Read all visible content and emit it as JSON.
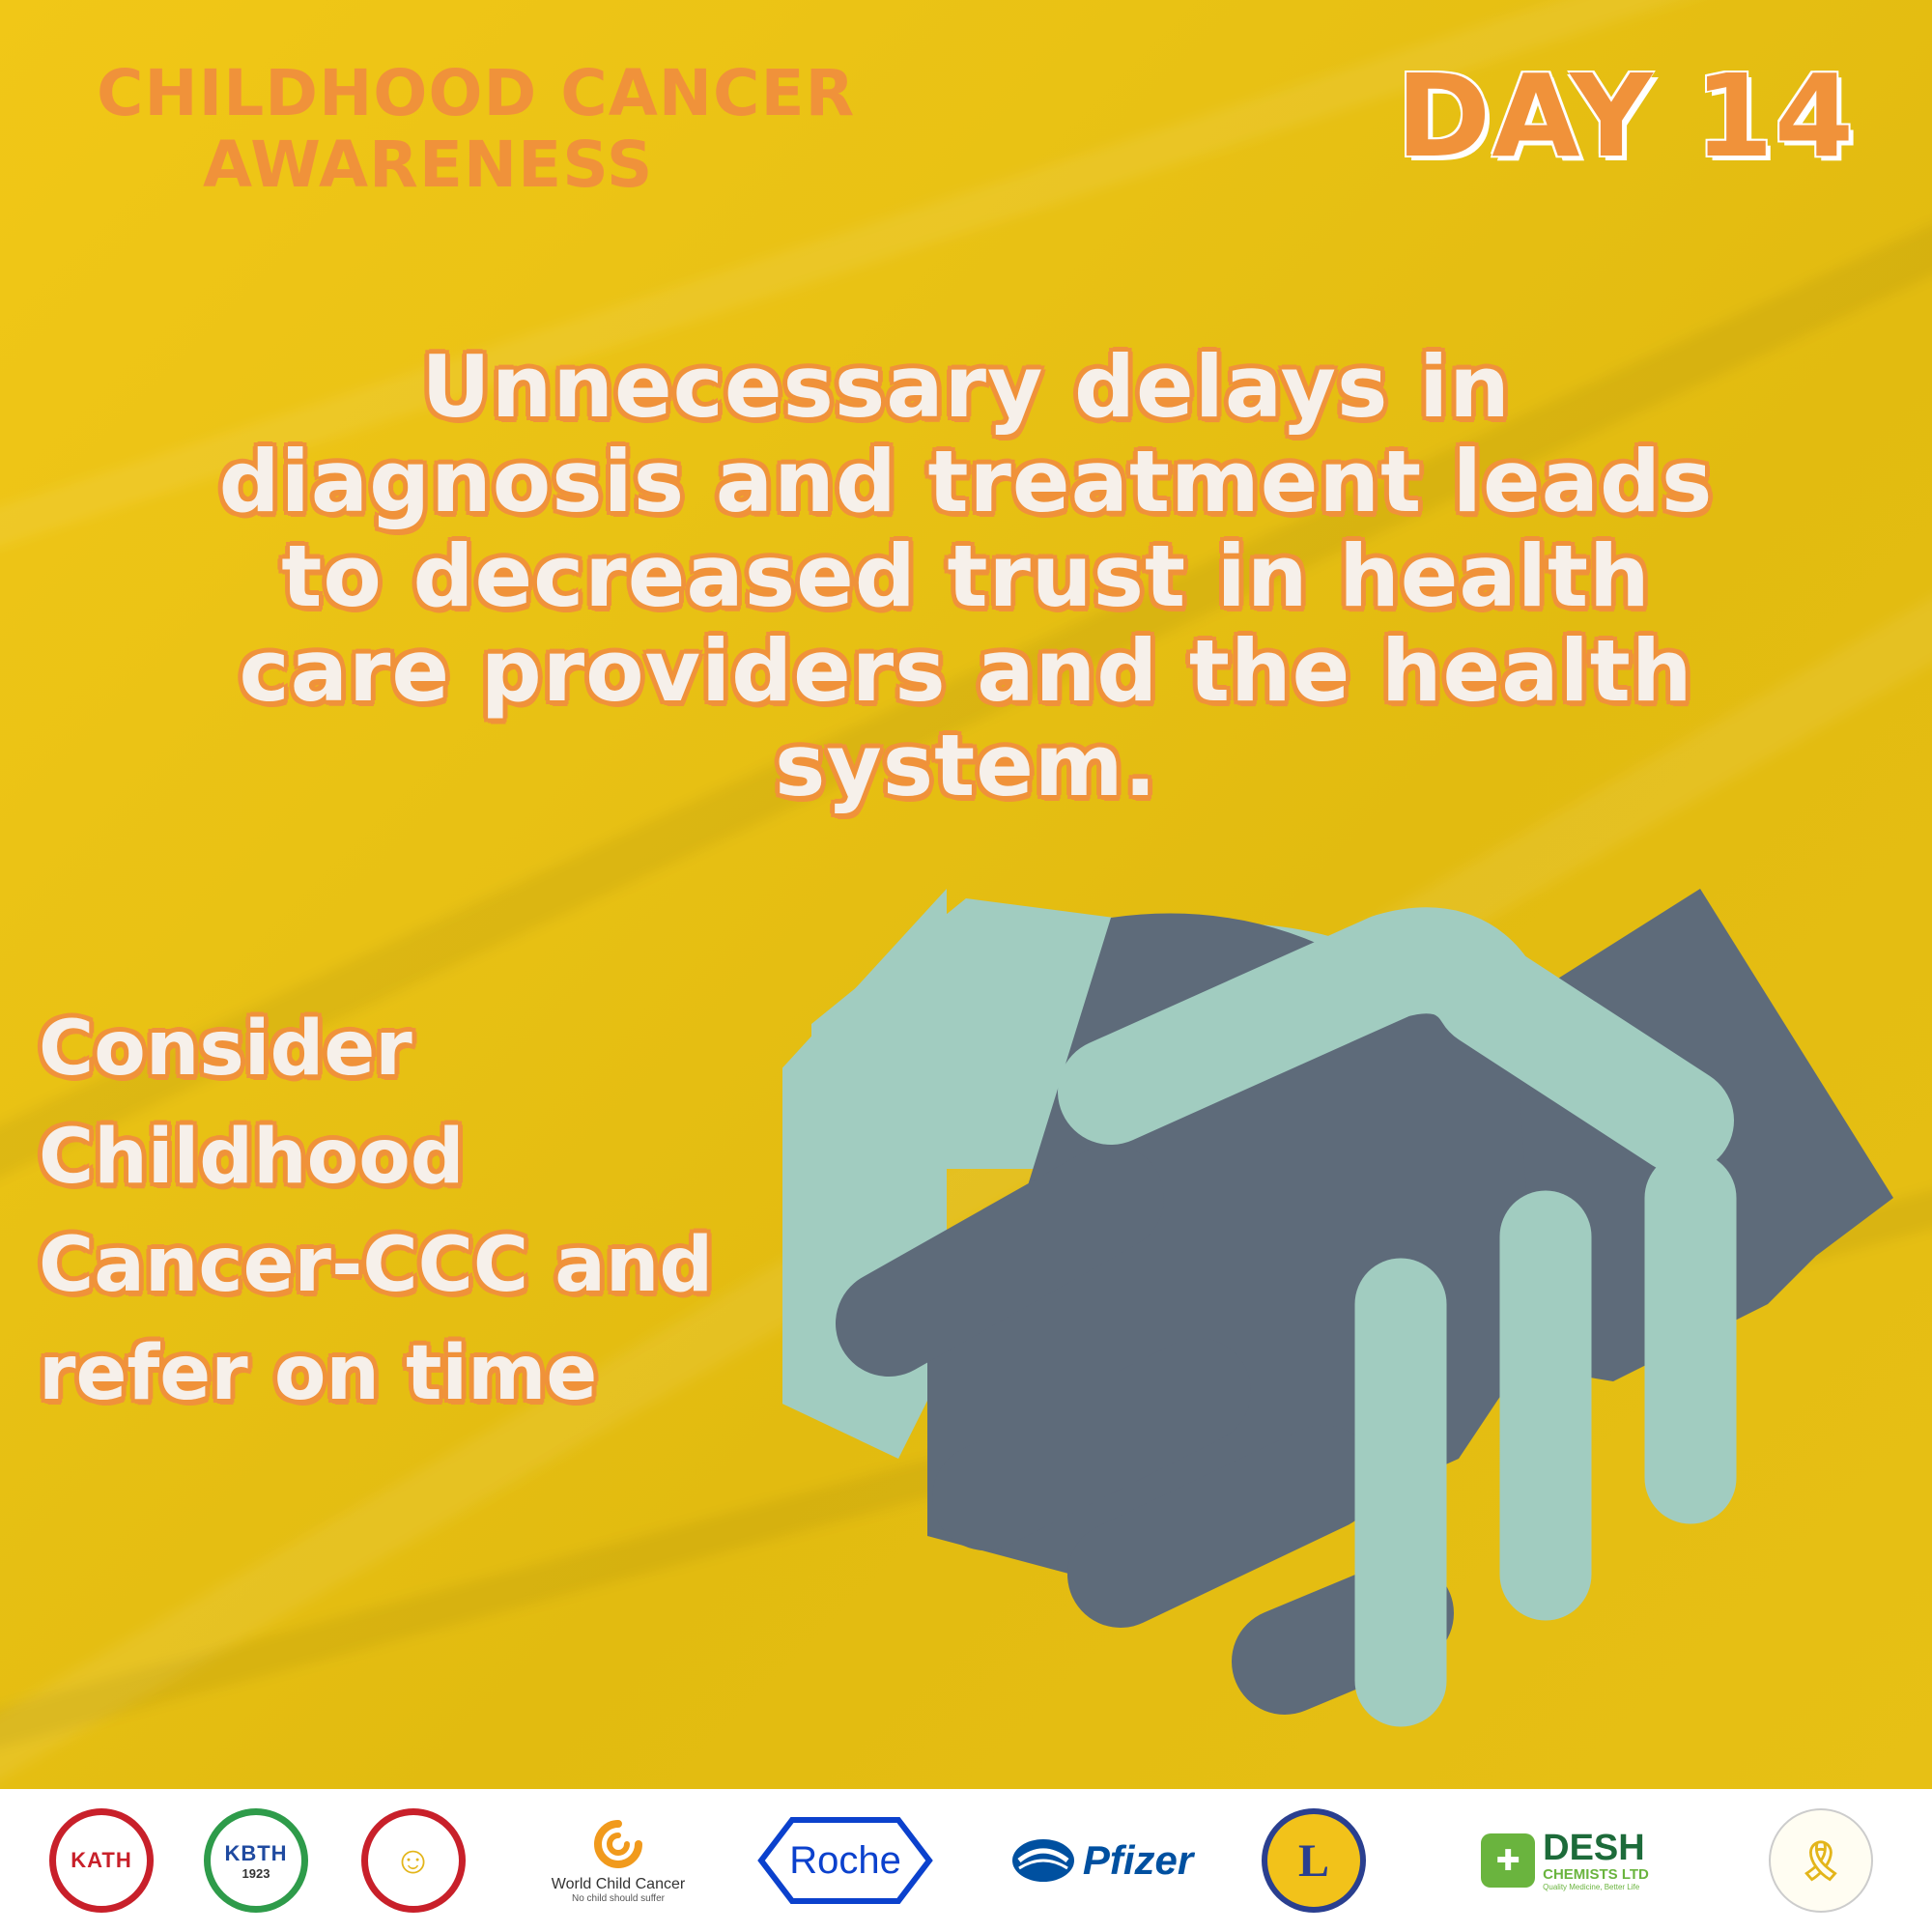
{
  "campaign": {
    "title_line1": "Childhood Cancer",
    "title_line2": "Awareness",
    "day": "DAY 14"
  },
  "message": {
    "lines": [
      "Unnecessary delays in",
      "diagnosis and treatment leads",
      "to decreased trust in health",
      "care providers and the health",
      "system."
    ]
  },
  "call_to_action": {
    "lines": [
      "Consider",
      "Childhood",
      "Cancer-CCC and",
      "refer on time"
    ]
  },
  "colors": {
    "background": "#e6bf13",
    "accent_orange": "#f0923a",
    "text_white": "#f6f0ea",
    "hand_mint": "#a1ccc0",
    "hand_slate": "#5e6b7a"
  },
  "illustration": {
    "icon": "handshake-icon"
  },
  "logos": {
    "kath": {
      "abbr": "KATH"
    },
    "kbth": {
      "abbr": "KBTH",
      "year": "1923"
    },
    "paediatric_society": {
      "name": "Paediatric Society of Ghana"
    },
    "world_child_cancer": {
      "name": "World Child Cancer",
      "tagline": "No child should suffer"
    },
    "roche": {
      "name": "Roche"
    },
    "pfizer": {
      "name": "Pfizer"
    },
    "lions": {
      "letter": "L",
      "name": "Lions International"
    },
    "desh": {
      "name": "DESH",
      "sub": "CHEMISTS LTD",
      "tagline": "Quality Medicine, Better Life"
    },
    "ccsg": {
      "name": "Childhood Cancer Society of Ghana"
    }
  }
}
